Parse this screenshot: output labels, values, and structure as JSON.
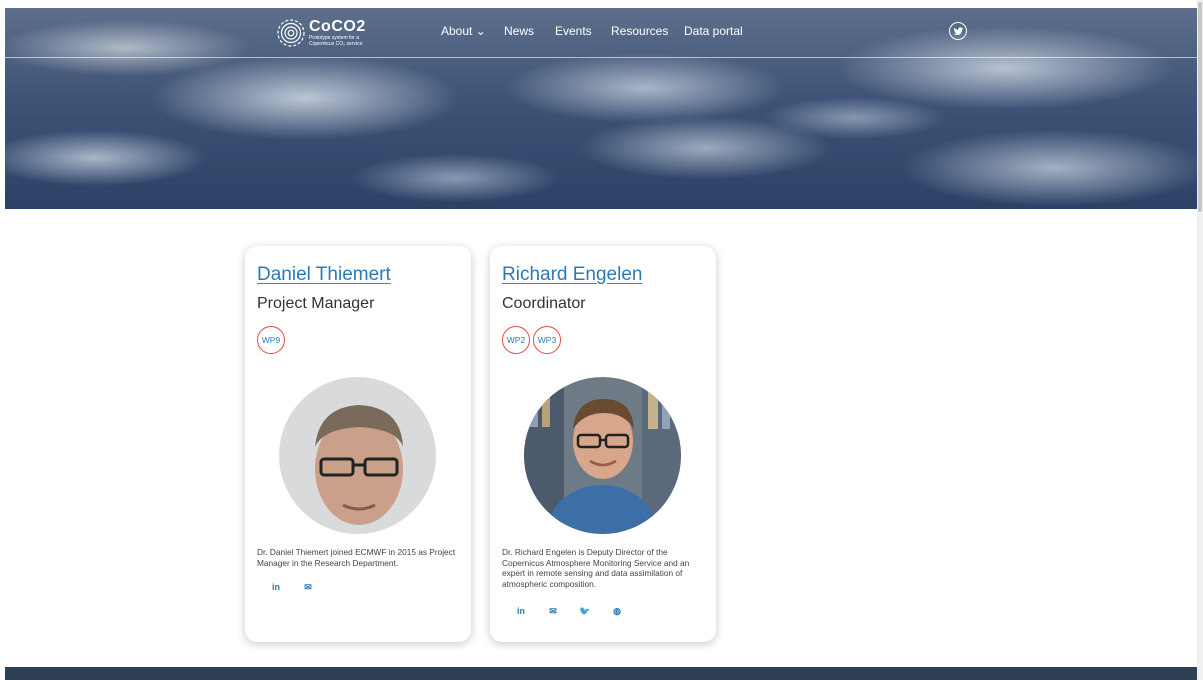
{
  "header": {
    "logo_title": "CoCO2",
    "logo_subtitle": "Prototype system for a Copernicus CO₂ service",
    "nav": [
      "About ⌄",
      "News",
      "Events",
      "Resources",
      "Data portal"
    ],
    "twitter_icon": "twitter-icon"
  },
  "cards": [
    {
      "name": "Daniel Thiemert",
      "role": "Project Manager",
      "wps": [
        "WP9"
      ],
      "bio": "Dr. Daniel Thiemert joined ECMWF in 2015 as Project Manager in the Research Department.",
      "socials": [
        "in",
        "✉"
      ]
    },
    {
      "name": "Richard Engelen",
      "role": "Coordinator",
      "wps": [
        "WP2",
        "WP3"
      ],
      "bio": "Dr. Richard Engelen is Deputy Director of the Copernicus Atmosphere Monitoring Service and an expert in remote sensing and data assimilation of atmospheric composition.",
      "socials": [
        "in",
        "✉",
        "🐦",
        "◍"
      ]
    }
  ],
  "colors": {
    "accent": "#2a7ab8",
    "underline": "#e4483f",
    "footer": "#2e3f56"
  }
}
